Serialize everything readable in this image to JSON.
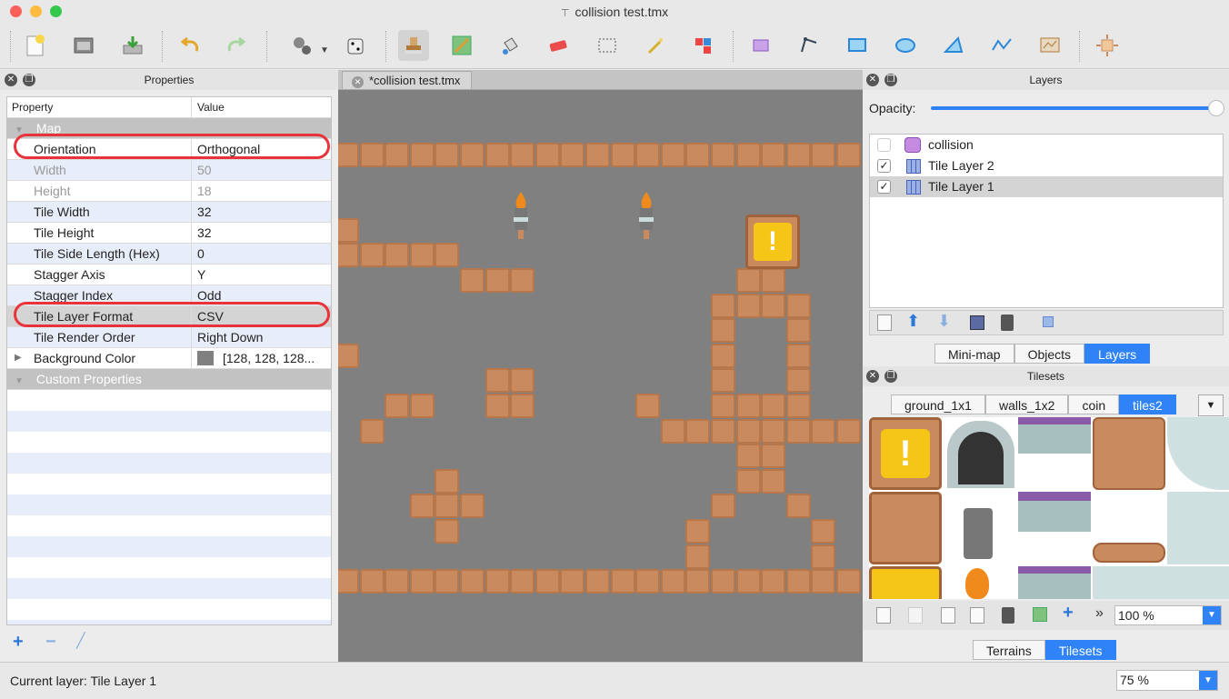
{
  "window": {
    "title": "collision test.tmx"
  },
  "properties_panel": {
    "title": "Properties",
    "col_property": "Property",
    "col_value": "Value",
    "section_map": "Map",
    "rows": [
      {
        "key": "Orientation",
        "value": "Orthogonal"
      },
      {
        "key": "Width",
        "value": "50"
      },
      {
        "key": "Height",
        "value": "18"
      },
      {
        "key": "Tile Width",
        "value": "32"
      },
      {
        "key": "Tile Height",
        "value": "32"
      },
      {
        "key": "Tile Side Length (Hex)",
        "value": "0"
      },
      {
        "key": "Stagger Axis",
        "value": "Y"
      },
      {
        "key": "Stagger Index",
        "value": "Odd"
      },
      {
        "key": "Tile Layer Format",
        "value": "CSV"
      },
      {
        "key": "Tile Render Order",
        "value": "Right Down"
      },
      {
        "key": "Background Color",
        "value": "[128, 128, 128..."
      }
    ],
    "section_custom": "Custom Properties"
  },
  "editor": {
    "tab_label": "*collision test.tmx"
  },
  "layers_panel": {
    "title": "Layers",
    "opacity_label": "Opacity:",
    "opacity_value": 1.0,
    "layers": [
      {
        "name": "collision",
        "checked": false
      },
      {
        "name": "Tile Layer 2",
        "checked": true
      },
      {
        "name": "Tile Layer 1",
        "checked": true
      }
    ],
    "tabs": [
      "Mini-map",
      "Objects",
      "Layers"
    ]
  },
  "tilesets_panel": {
    "title": "Tilesets",
    "tabs": [
      "ground_1x1",
      "walls_1x2",
      "coin",
      "tiles2"
    ],
    "zoom": "100 %",
    "bottom_tabs": [
      "Terrains",
      "Tilesets"
    ]
  },
  "status": {
    "current_layer": "Current layer: Tile Layer 1",
    "zoom": "75 %"
  },
  "colors": {
    "accent": "#2f83f6",
    "highlight": "#e8333a",
    "tile": "#c98b5e",
    "canvas": "#808080"
  }
}
